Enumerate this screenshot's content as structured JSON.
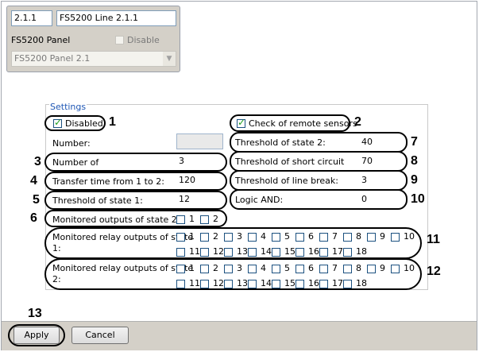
{
  "top_panel": {
    "id_value": "2.1.1",
    "name_value": "FS5200 Line 2.1.1",
    "panel_label": "FS5200 Panel",
    "disable_label": "Disable",
    "panel_select_value": "FS5200 Panel 2.1"
  },
  "settings": {
    "title": "Settings",
    "disabled_label": "Disabled",
    "check_remote_label": "Check of remote sensors",
    "number_label": "Number:",
    "number_of_label": "Number of",
    "number_of_value": "3",
    "transfer_label": "Transfer time from 1 to 2:",
    "transfer_value": "120",
    "threshold1_label": "Threshold of state 1:",
    "threshold1_value": "12",
    "monitored_outputs_label": "Monitored outputs of state 2:",
    "monitored_outputs_options": [
      "1",
      "2"
    ],
    "threshold2_label": "Threshold of state 2:",
    "threshold2_value": "40",
    "short_circuit_label": "Threshold of short circuit",
    "short_circuit_value": "70",
    "line_break_label": "Threshold of line break:",
    "line_break_value": "3",
    "logic_and_label": "Logic AND:",
    "logic_and_value": "0",
    "relay1_label_line1": "Monitored relay outputs of state",
    "relay1_label_line2": "1:",
    "relay2_label_line1": "Monitored relay outputs of state",
    "relay2_label_line2": "2:",
    "relay_numbers": [
      "1",
      "2",
      "3",
      "4",
      "5",
      "6",
      "7",
      "8",
      "9",
      "10",
      "11",
      "12",
      "13",
      "14",
      "15",
      "16",
      "17",
      "18"
    ]
  },
  "callouts": {
    "n1": "1",
    "n2": "2",
    "n3": "3",
    "n4": "4",
    "n5": "5",
    "n6": "6",
    "n7": "7",
    "n8": "8",
    "n9": "9",
    "n10": "10",
    "n11": "11",
    "n12": "12",
    "n13": "13"
  },
  "buttons": {
    "apply": "Apply",
    "cancel": "Cancel"
  }
}
